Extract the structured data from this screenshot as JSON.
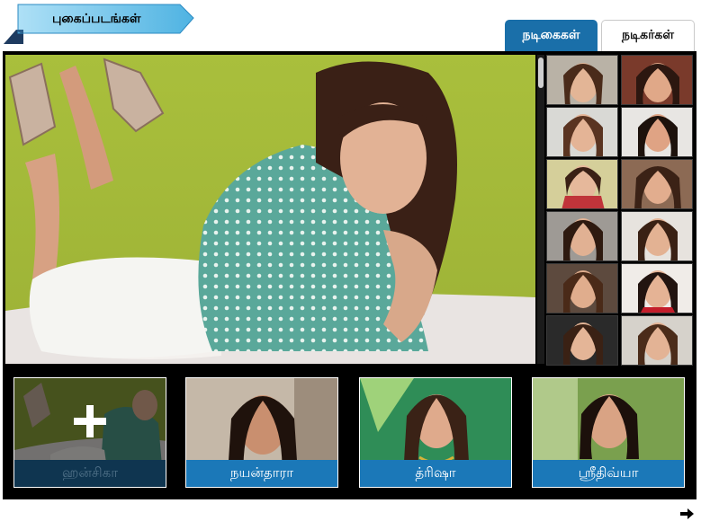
{
  "header": {
    "title": "புகைப்படங்கள்"
  },
  "tabs": [
    {
      "label": "நடிகைகள்",
      "active": true
    },
    {
      "label": "நடிகர்கள்",
      "active": false
    }
  ],
  "colors": {
    "accent": "#1a6fa9",
    "ribbon": "#5bbde8",
    "frame": "#000000"
  },
  "cards": [
    {
      "label": "ஹன்சிகா",
      "selected": true
    },
    {
      "label": "நயன்தாரா",
      "selected": false
    },
    {
      "label": "த்ரிஷா",
      "selected": false
    },
    {
      "label": "ஸ்ரீதிவ்யா",
      "selected": false
    }
  ],
  "icons": {
    "add": "plus-icon",
    "next": "arrow-right-icon"
  }
}
